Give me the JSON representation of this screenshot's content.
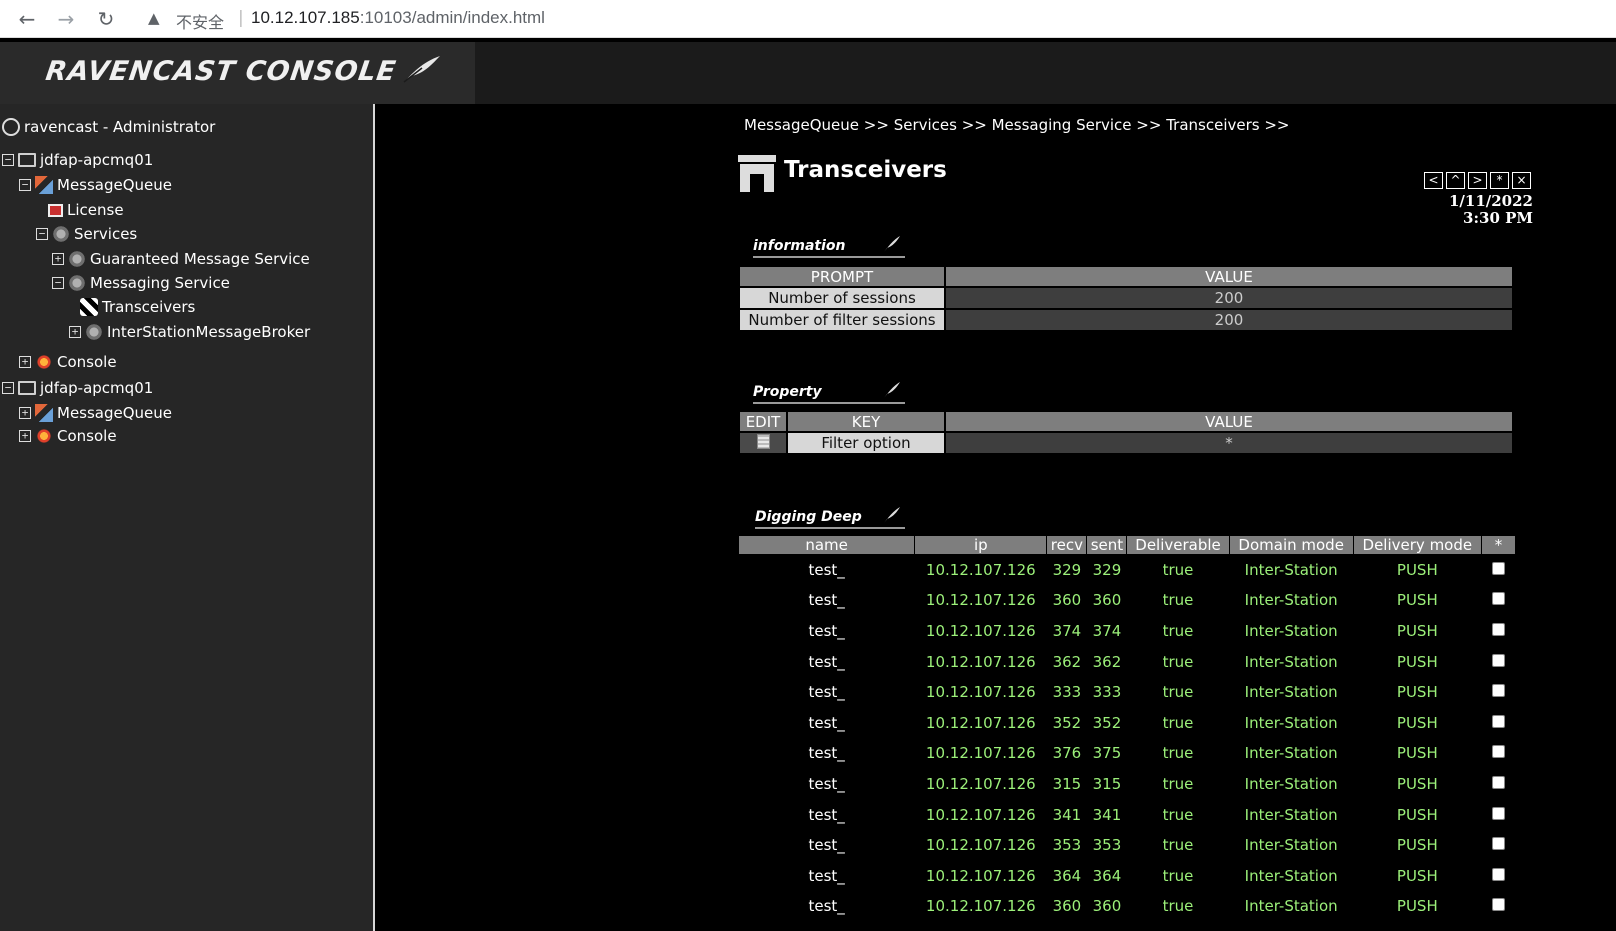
{
  "browser": {
    "insecure_label": "不安全",
    "url_host": "10.12.107.185",
    "url_rest": ":10103/admin/index.html"
  },
  "header": {
    "logo_text": "RAVENCAST CONSOLE"
  },
  "sidebar": {
    "user": "ravencast - Administrator",
    "tree": [
      {
        "label": "jdfap-apcmq01",
        "toggle": "⊟",
        "icon": "monitor-icon"
      },
      {
        "label": "MessageQueue",
        "toggle": "⊟",
        "icon": "message-queue-icon"
      },
      {
        "label": "License",
        "toggle": "",
        "icon": "license-icon"
      },
      {
        "label": "Services",
        "toggle": "⊟",
        "icon": "gear-icon"
      },
      {
        "label": "Guaranteed Message Service",
        "toggle": "⊞",
        "icon": "gear-icon"
      },
      {
        "label": "Messaging Service",
        "toggle": "⊟",
        "icon": "gear-icon"
      },
      {
        "label": "Transceivers",
        "toggle": "",
        "icon": "transceiver-icon"
      },
      {
        "label": "InterStationMessageBroker",
        "toggle": "⊞",
        "icon": "gear-icon"
      },
      {
        "label": "Console",
        "toggle": "⊞",
        "icon": "console-icon"
      },
      {
        "label": "jdfap-apcmq01",
        "toggle": "⊟",
        "icon": "monitor-icon"
      },
      {
        "label": "MessageQueue",
        "toggle": "⊞",
        "icon": "message-queue-icon"
      },
      {
        "label": "Console",
        "toggle": "⊞",
        "icon": "console-icon"
      }
    ]
  },
  "main": {
    "breadcrumb": "MessageQueue >> Services >> Messaging Service >> Transceivers >>",
    "title": "Transceivers",
    "date": "1/11/2022",
    "time": "3:30 PM",
    "window_controls": [
      "<",
      "^",
      ">",
      "*",
      "×"
    ],
    "information": {
      "heading": "information",
      "headers": [
        "PROMPT",
        "VALUE"
      ],
      "rows": [
        {
          "prompt": "Number of sessions",
          "value": "200"
        },
        {
          "prompt": "Number of filter sessions",
          "value": "200"
        }
      ]
    },
    "property": {
      "heading": "Property",
      "headers": [
        "EDIT",
        "KEY",
        "VALUE"
      ],
      "rows": [
        {
          "key": "Filter option",
          "value": "*"
        }
      ]
    },
    "digging": {
      "heading": "Digging Deep",
      "headers": [
        "name",
        "ip",
        "recv",
        "sent",
        "Deliverable",
        "Domain mode",
        "Delivery mode",
        "*"
      ],
      "rows": [
        {
          "name": "test_",
          "ip": "10.12.107.126",
          "recv": "329",
          "sent": "329",
          "deliverable": "true",
          "domain": "Inter-Station",
          "delivery": "PUSH"
        },
        {
          "name": "test_",
          "ip": "10.12.107.126",
          "recv": "360",
          "sent": "360",
          "deliverable": "true",
          "domain": "Inter-Station",
          "delivery": "PUSH"
        },
        {
          "name": "test_",
          "ip": "10.12.107.126",
          "recv": "374",
          "sent": "374",
          "deliverable": "true",
          "domain": "Inter-Station",
          "delivery": "PUSH"
        },
        {
          "name": "test_",
          "ip": "10.12.107.126",
          "recv": "362",
          "sent": "362",
          "deliverable": "true",
          "domain": "Inter-Station",
          "delivery": "PUSH"
        },
        {
          "name": "test_",
          "ip": "10.12.107.126",
          "recv": "333",
          "sent": "333",
          "deliverable": "true",
          "domain": "Inter-Station",
          "delivery": "PUSH"
        },
        {
          "name": "test_",
          "ip": "10.12.107.126",
          "recv": "352",
          "sent": "352",
          "deliverable": "true",
          "domain": "Inter-Station",
          "delivery": "PUSH"
        },
        {
          "name": "test_",
          "ip": "10.12.107.126",
          "recv": "376",
          "sent": "375",
          "deliverable": "true",
          "domain": "Inter-Station",
          "delivery": "PUSH"
        },
        {
          "name": "test_",
          "ip": "10.12.107.126",
          "recv": "315",
          "sent": "315",
          "deliverable": "true",
          "domain": "Inter-Station",
          "delivery": "PUSH"
        },
        {
          "name": "test_",
          "ip": "10.12.107.126",
          "recv": "341",
          "sent": "341",
          "deliverable": "true",
          "domain": "Inter-Station",
          "delivery": "PUSH"
        },
        {
          "name": "test_",
          "ip": "10.12.107.126",
          "recv": "353",
          "sent": "353",
          "deliverable": "true",
          "domain": "Inter-Station",
          "delivery": "PUSH"
        },
        {
          "name": "test_",
          "ip": "10.12.107.126",
          "recv": "364",
          "sent": "364",
          "deliverable": "true",
          "domain": "Inter-Station",
          "delivery": "PUSH"
        },
        {
          "name": "test_",
          "ip": "10.12.107.126",
          "recv": "360",
          "sent": "360",
          "deliverable": "true",
          "domain": "Inter-Station",
          "delivery": "PUSH"
        }
      ]
    }
  }
}
